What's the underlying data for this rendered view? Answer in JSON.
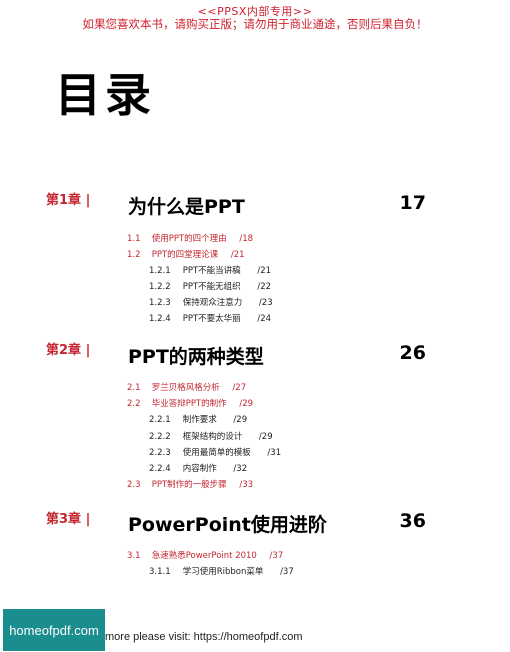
{
  "header": {
    "line1": "<<PPSX内部专用>>",
    "line2": "如果您喜欢本书，请购买正版；请勿用于商业通途，否则后果自负！"
  },
  "toc_title": "目录",
  "chapters": [
    {
      "label": "第1章 |",
      "title": "为什么是PPT",
      "page": "17",
      "sections": [
        {
          "num": "1.1",
          "title": "使用PPT的四个理由",
          "page": "/18"
        },
        {
          "num": "1.2",
          "title": "PPT的四堂理论课",
          "page": "/21"
        }
      ],
      "subsections": [
        {
          "num": "1.2.1",
          "title": "PPT不能当讲稿",
          "page": "/21"
        },
        {
          "num": "1.2.2",
          "title": "PPT不能无组织",
          "page": "/22"
        },
        {
          "num": "1.2.3",
          "title": "保持观众注意力",
          "page": "/23"
        },
        {
          "num": "1.2.4",
          "title": "PPT不要太华丽",
          "page": "/24"
        }
      ]
    },
    {
      "label": "第2章 |",
      "title": "PPT的两种类型",
      "page": "26",
      "sections": [
        {
          "num": "2.1",
          "title": "罗兰贝格风格分析",
          "page": "/27"
        },
        {
          "num": "2.2",
          "title": "毕业答辩PPT的制作",
          "page": "/29"
        },
        {
          "num": "2.3",
          "title": "PPT制作的一般步骤",
          "page": "/33"
        }
      ],
      "subsections": [
        {
          "num": "2.2.1",
          "title": "制作要求",
          "page": "/29"
        },
        {
          "num": "2.2.2",
          "title": "框架结构的设计",
          "page": "/29"
        },
        {
          "num": "2.2.3",
          "title": "使用最简单的模板",
          "page": "/31"
        },
        {
          "num": "2.2.4",
          "title": "内容制作",
          "page": "/32"
        }
      ]
    },
    {
      "label": "第3章 |",
      "title": "PowerPoint使用进阶",
      "page": "36",
      "sections": [
        {
          "num": "3.1",
          "title": "急速熟悉PowerPoint 2010",
          "page": "/37"
        }
      ],
      "subsections": [
        {
          "num": "3.1.1",
          "title": "学习使用Ribbon菜单",
          "page": "/37"
        }
      ]
    }
  ],
  "footer": {
    "badge": "homeofpdf.com",
    "text": "more please visit: https://homeofpdf.com"
  }
}
